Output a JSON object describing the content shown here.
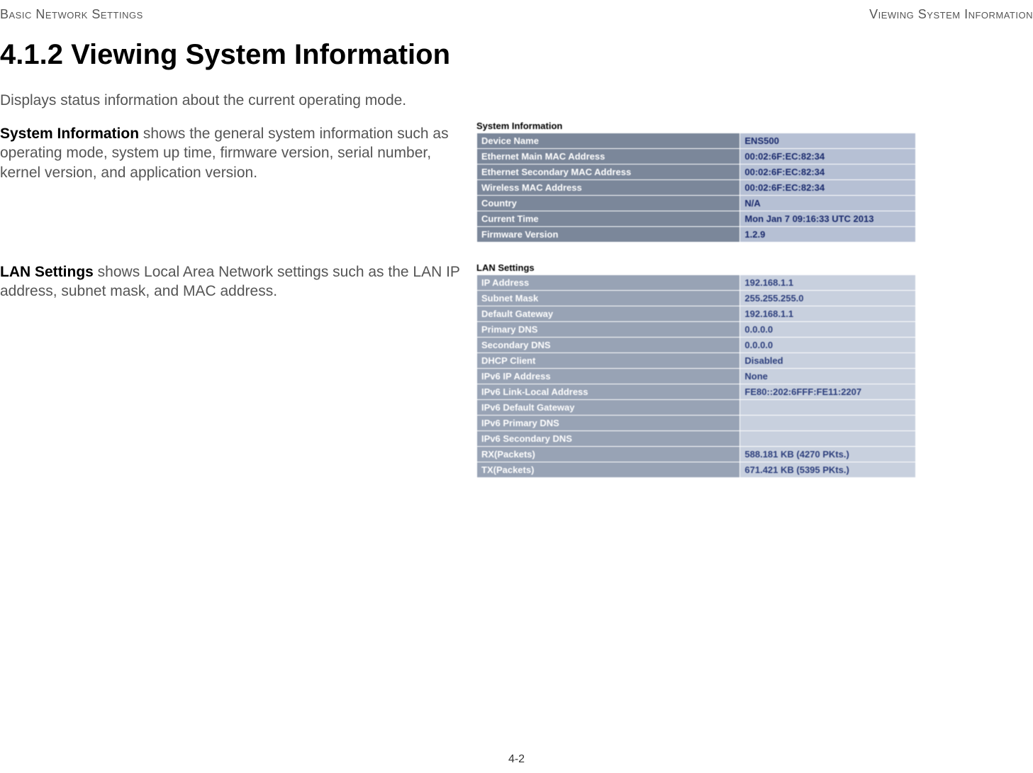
{
  "header": {
    "left": "Basic Network Settings",
    "right": "Viewing System Information"
  },
  "heading": "4.1.2 Viewing System Information",
  "intro": "Displays status information about the current operating mode.",
  "sysinfo_desc": {
    "bold": "System Information",
    "rest": "  shows the general system information such as operating mode, system up time, firmware version, serial number, kernel version, and application version."
  },
  "lan_desc": {
    "bold": "LAN Settings",
    "rest": "  shows Local Area Network settings such as the LAN IP address, subnet mask, and MAC address."
  },
  "sysinfo_caption": "System Information",
  "sysinfo_rows": [
    {
      "label": "Device Name",
      "value": "ENS500"
    },
    {
      "label": "Ethernet Main MAC Address",
      "value": "00:02:6F:EC:82:34"
    },
    {
      "label": "Ethernet Secondary MAC Address",
      "value": "00:02:6F:EC:82:34"
    },
    {
      "label": "Wireless MAC Address",
      "value": "00:02:6F:EC:82:34"
    },
    {
      "label": "Country",
      "value": "N/A"
    },
    {
      "label": "Current Time",
      "value": "Mon Jan 7 09:16:33 UTC 2013"
    },
    {
      "label": "Firmware Version",
      "value": "1.2.9"
    }
  ],
  "lan_caption": "LAN Settings",
  "lan_rows": [
    {
      "label": "IP Address",
      "value": "192.168.1.1"
    },
    {
      "label": "Subnet Mask",
      "value": "255.255.255.0"
    },
    {
      "label": "Default Gateway",
      "value": "192.168.1.1"
    },
    {
      "label": "Primary DNS",
      "value": "0.0.0.0"
    },
    {
      "label": "Secondary DNS",
      "value": "0.0.0.0"
    },
    {
      "label": "DHCP Client",
      "value": "Disabled"
    },
    {
      "label": "IPv6 IP Address",
      "value": "None"
    },
    {
      "label": "IPv6 Link-Local Address",
      "value": "FE80::202:6FFF:FE11:2207"
    },
    {
      "label": "IPv6 Default Gateway",
      "value": ""
    },
    {
      "label": "IPv6 Primary DNS",
      "value": ""
    },
    {
      "label": "IPv6 Secondary DNS",
      "value": ""
    },
    {
      "label": "RX(Packets)",
      "value": "588.181 KB (4270 PKts.)"
    },
    {
      "label": "TX(Packets)",
      "value": "671.421 KB (5395 PKts.)"
    }
  ],
  "page_number": "4-2"
}
